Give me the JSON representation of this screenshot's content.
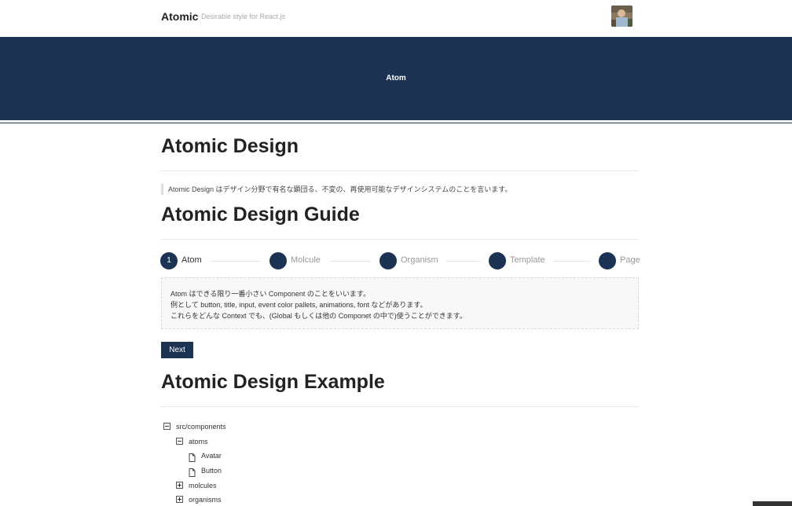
{
  "header": {
    "brand": "Atomic",
    "tagline": "Desirable style for React.js",
    "avatar_icon": "user-avatar-photo"
  },
  "hero": {
    "title": "Atom",
    "background": "#1c3354"
  },
  "section_design": {
    "heading": "Atomic Design",
    "quote": "Atomic Design はデザイン分野で有名な顕団る、不変の、再使用可能なデザインシステムのことを言います。"
  },
  "section_guide": {
    "heading": "Atomic Design Guide",
    "steps": [
      {
        "number": "1",
        "label": "Atom"
      },
      {
        "number": "",
        "label": "Molcule"
      },
      {
        "number": "",
        "label": "Organism"
      },
      {
        "number": "",
        "label": "Template"
      },
      {
        "number": "",
        "label": "Page"
      }
    ],
    "active_step": 0,
    "description": [
      "Atom はできる限り一番小さい Component のことをいいます。",
      "例として button, title, input, event color pallets, animations, font などがあります。",
      "これらをどんな Context でも、(Global もしくは他の Componet の中で)使うことができます。"
    ],
    "next_label": "Next"
  },
  "section_example": {
    "heading": "Atomic Design Example",
    "tree": [
      {
        "label": "src/components",
        "icon": "minus-box-icon",
        "depth": 0
      },
      {
        "label": "atoms",
        "icon": "minus-box-icon",
        "depth": 1
      },
      {
        "label": "Avatar",
        "icon": "file-icon",
        "depth": 2
      },
      {
        "label": "Button",
        "icon": "file-icon",
        "depth": 2
      },
      {
        "label": "molcules",
        "icon": "plus-box-icon",
        "depth": 1
      },
      {
        "label": "organisms",
        "icon": "plus-box-icon",
        "depth": 1
      }
    ]
  },
  "colors": {
    "primary": "#1c3354",
    "text": "#333333",
    "muted": "#999999"
  }
}
